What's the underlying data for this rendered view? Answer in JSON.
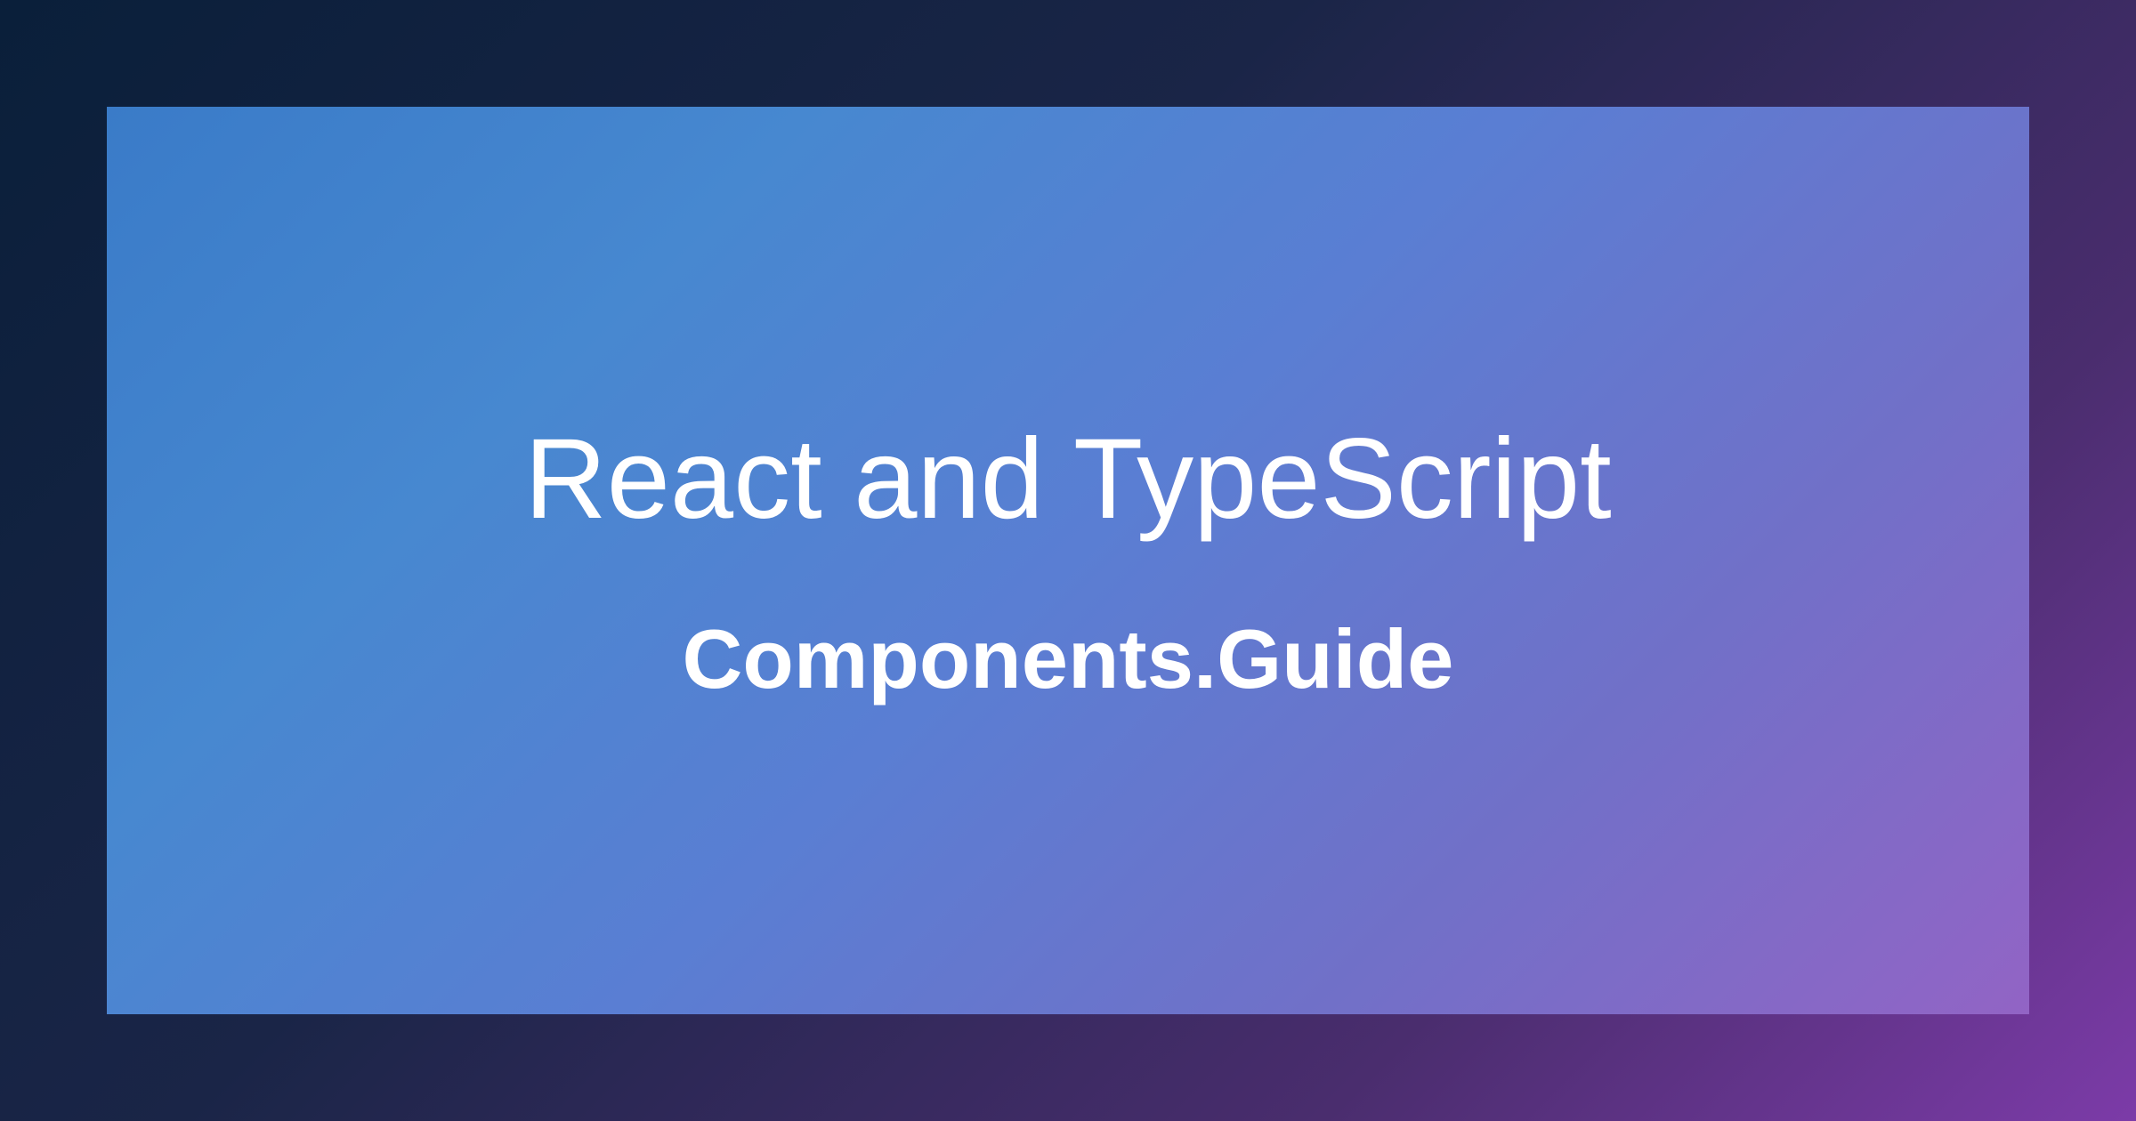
{
  "title": "React and TypeScript",
  "subtitle": "Components.Guide"
}
